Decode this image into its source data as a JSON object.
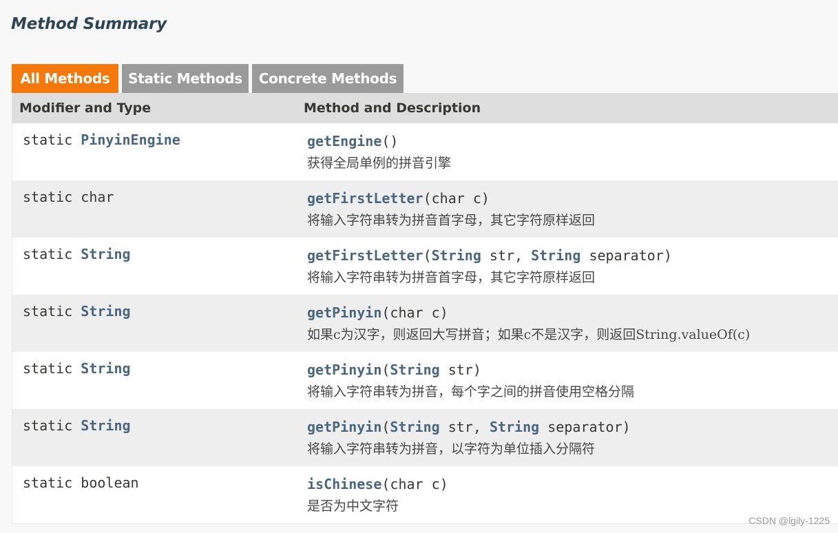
{
  "page": {
    "title": "Method Summary"
  },
  "tabs": [
    {
      "label": "All Methods",
      "active": true
    },
    {
      "label": "Static Methods",
      "active": false
    },
    {
      "label": "Concrete Methods",
      "active": false
    }
  ],
  "table": {
    "headers": {
      "modifier": "Modifier and Type",
      "method": "Method and Description"
    },
    "rows": [
      {
        "modifier": "static",
        "type": "PinyinEngine",
        "type_is_link": true,
        "method": "getEngine",
        "params": [],
        "description": "获得全局单例的拼音引擎"
      },
      {
        "modifier": "static",
        "type": "char",
        "type_is_link": false,
        "method": "getFirstLetter",
        "params": [
          {
            "type": "char",
            "type_is_link": false,
            "name": "c"
          }
        ],
        "description": "将输入字符串转为拼音首字母，其它字符原样返回"
      },
      {
        "modifier": "static",
        "type": "String",
        "type_is_link": true,
        "method": "getFirstLetter",
        "params": [
          {
            "type": "String",
            "type_is_link": true,
            "name": "str"
          },
          {
            "type": "String",
            "type_is_link": true,
            "name": "separator"
          }
        ],
        "description": "将输入字符串转为拼音首字母，其它字符原样返回"
      },
      {
        "modifier": "static",
        "type": "String",
        "type_is_link": true,
        "method": "getPinyin",
        "params": [
          {
            "type": "char",
            "type_is_link": false,
            "name": "c"
          }
        ],
        "description": "如果c为汉字，则返回大写拼音；如果c不是汉字，则返回String.valueOf(c)"
      },
      {
        "modifier": "static",
        "type": "String",
        "type_is_link": true,
        "method": "getPinyin",
        "params": [
          {
            "type": "String",
            "type_is_link": true,
            "name": "str"
          }
        ],
        "description": "将输入字符串转为拼音，每个字之间的拼音使用空格分隔"
      },
      {
        "modifier": "static",
        "type": "String",
        "type_is_link": true,
        "method": "getPinyin",
        "params": [
          {
            "type": "String",
            "type_is_link": true,
            "name": "str"
          },
          {
            "type": "String",
            "type_is_link": true,
            "name": "separator"
          }
        ],
        "description": "将输入字符串转为拼音，以字符为单位插入分隔符"
      },
      {
        "modifier": "static",
        "type": "boolean",
        "type_is_link": false,
        "method": "isChinese",
        "params": [
          {
            "type": "char",
            "type_is_link": false,
            "name": "c"
          }
        ],
        "description": "是否为中文字符"
      }
    ]
  },
  "watermark": "CSDN @lgily-1225",
  "colors": {
    "tab_active": "#f5780a",
    "tab_inactive": "#9a9a9a",
    "link": "#4a6782",
    "header_bg": "#dedede",
    "row_alt_bg": "#eeeeee"
  }
}
